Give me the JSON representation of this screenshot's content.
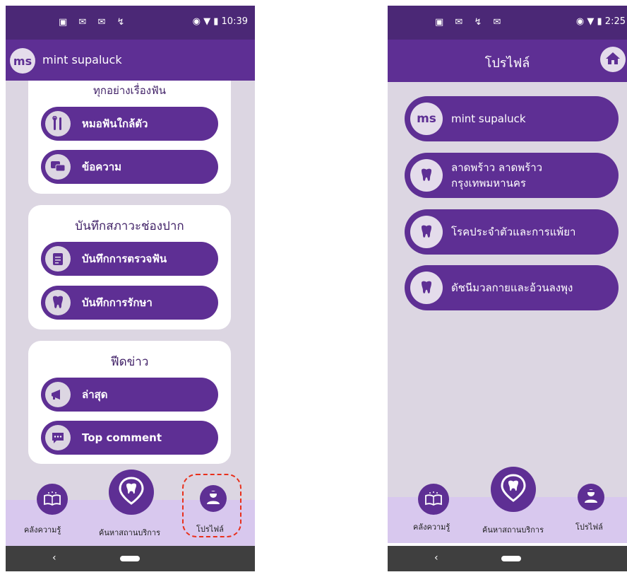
{
  "left_screen": {
    "status_bar": {
      "time": "10:39",
      "icons": [
        "sim-icon",
        "gmail-icon",
        "gmail-icon",
        "link-icon"
      ]
    },
    "header": {
      "avatar_initials": "ms",
      "user_name": "mint supaluck"
    },
    "section_top": {
      "title_partial": "ทุกอย่างเรื่องฟัน",
      "buttons": [
        {
          "label": "หมอฟันใกล้ตัว",
          "icon": "dental-tools-icon"
        },
        {
          "label": "ข้อความ",
          "icon": "chat-icon"
        }
      ]
    },
    "section_oral": {
      "title": "บันทึกสภาวะช่องปาก",
      "buttons": [
        {
          "label": "บันทึกการตรวจฟัน",
          "icon": "notepad-icon"
        },
        {
          "label": "บันทึกการรักษา",
          "icon": "tooth-sparkle-icon"
        }
      ]
    },
    "section_feed": {
      "title": "ฟีดข่าว",
      "buttons": [
        {
          "label": "ล่าสุด",
          "icon": "megaphone-icon"
        },
        {
          "label": "Top comment",
          "icon": "comment-icon"
        }
      ]
    },
    "bottom_nav": {
      "knowledge_label": "คลังความรู้",
      "search_label": "ค้นหาสถานบริการ",
      "profile_label": "โปรไฟล์"
    },
    "highlight_color": "#e8301c"
  },
  "right_screen": {
    "status_bar": {
      "time": "2:25"
    },
    "header": {
      "title": "โปรไฟล์"
    },
    "profile_items": [
      {
        "avatar_initials": "ms",
        "line1": "mint supaluck",
        "line2": "",
        "icon": "avatar"
      },
      {
        "line1": "ลาดพร้าว ลาดพร้าว",
        "line2": "กรุงเทพมหานคร",
        "icon": "tooth-icon"
      },
      {
        "line1": "โรคประจำตัวและการแพ้ยา",
        "line2": "",
        "icon": "tooth-icon"
      },
      {
        "line1": "ดัชนีมวลกายและอ้วนลงพุง",
        "line2": "",
        "icon": "tooth-icon"
      }
    ],
    "bottom_nav": {
      "knowledge_label": "คลังความรู้",
      "search_label": "ค้นหาสถานบริการ",
      "profile_label": "โปรไฟล์"
    }
  },
  "colors": {
    "primary": "#5e2f94",
    "status": "#4b2876",
    "background": "#dcd6e2",
    "nav_bg": "#d8c8ee"
  }
}
